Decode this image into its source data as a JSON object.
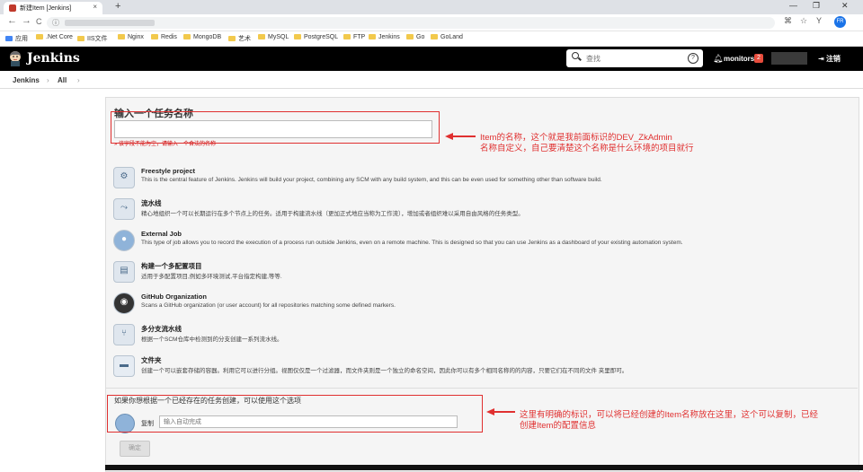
{
  "browser": {
    "tab_title": "新建Item [Jenkins]",
    "tab_close": "×",
    "new_tab": "+",
    "window_controls": [
      "—",
      "❐",
      "✕"
    ],
    "nav": [
      "←",
      "→",
      "C"
    ],
    "profile_initials": "FR",
    "bookmarks": [
      "应用",
      ".Net Core",
      "IIS文件",
      "Nginx",
      "Redis",
      "MongoDB",
      "艺术",
      "MySQL",
      "PostgreSQL",
      "FTP",
      "Jenkins",
      "Go",
      "GoLand"
    ]
  },
  "header": {
    "title": "Jenkins",
    "search_placeholder": "查找",
    "help": "?",
    "monitors_label": "monitors",
    "monitors_count": "2",
    "logout_label": "注销"
  },
  "breadcrumb": {
    "items": [
      "Jenkins",
      "All"
    ],
    "sep": "›"
  },
  "form": {
    "heading": "输入一个任务名称",
    "name_value": "",
    "name_hint": "» 该字段不能为空，请输入一个合法的名称",
    "item_types": [
      {
        "name": "Freestyle project",
        "desc": "This is the central feature of Jenkins. Jenkins will build your project, combining any SCM with any build system, and this can be even used for something other than software build.",
        "icon": "freestyle-icon"
      },
      {
        "name": "流水线",
        "desc": "精心地组织一个可以长期运行在多个节点上的任务。适用于构建流水线（更加正式地应当称为工作流），增加或者组织难以采用自由风格的任务类型。",
        "icon": "pipeline-icon"
      },
      {
        "name": "External Job",
        "desc": "This type of job allows you to record the execution of a process run outside Jenkins, even on a remote machine. This is designed so that you can use Jenkins as a dashboard of your existing automation system.",
        "icon": "external-job-icon"
      },
      {
        "name": "构建一个多配置项目",
        "desc": "适用于多配置项目,例如多环境测试,平台指定构建,等等.",
        "icon": "multi-config-icon"
      },
      {
        "name": "GitHub Organization",
        "desc": "Scans a GitHub organization (or user account) for all repositories matching some defined markers.",
        "icon": "github-icon"
      },
      {
        "name": "多分支流水线",
        "desc": "根据一个SCM仓库中检测到的分支创建一系列流水线。",
        "icon": "multibranch-icon"
      },
      {
        "name": "文件夹",
        "desc": "创建一个可以嵌套存储的容器。利用它可以进行分组。视图仅仅是一个过滤器，而文件夹则是一个独立的命名空间，因此你可以有多个相同名称的的内容，只要它们在不同的文件 夹里即可。",
        "icon": "folder-icon"
      }
    ],
    "copy_label": "如果你想根据一个已经存在的任务创建，可以使用这个选项",
    "copy_word": "复制",
    "copy_placeholder": "输入自动完成",
    "ok_label": "确定"
  },
  "annotations": {
    "note1_line1": "Item的名称，这个就是我前面标识的DEV_ZkAdmin",
    "note1_line2": "名称自定义，自己要清楚这个名称是什么环境的项目就行",
    "note2_line1": "这里有明确的标识，可以将已经创建的Item名称放在这里，这个可以复制，已经",
    "note2_line2": "创建Item的配置信息"
  },
  "colors": {
    "annotation_red": "#e03030",
    "header_bg": "#000000"
  }
}
